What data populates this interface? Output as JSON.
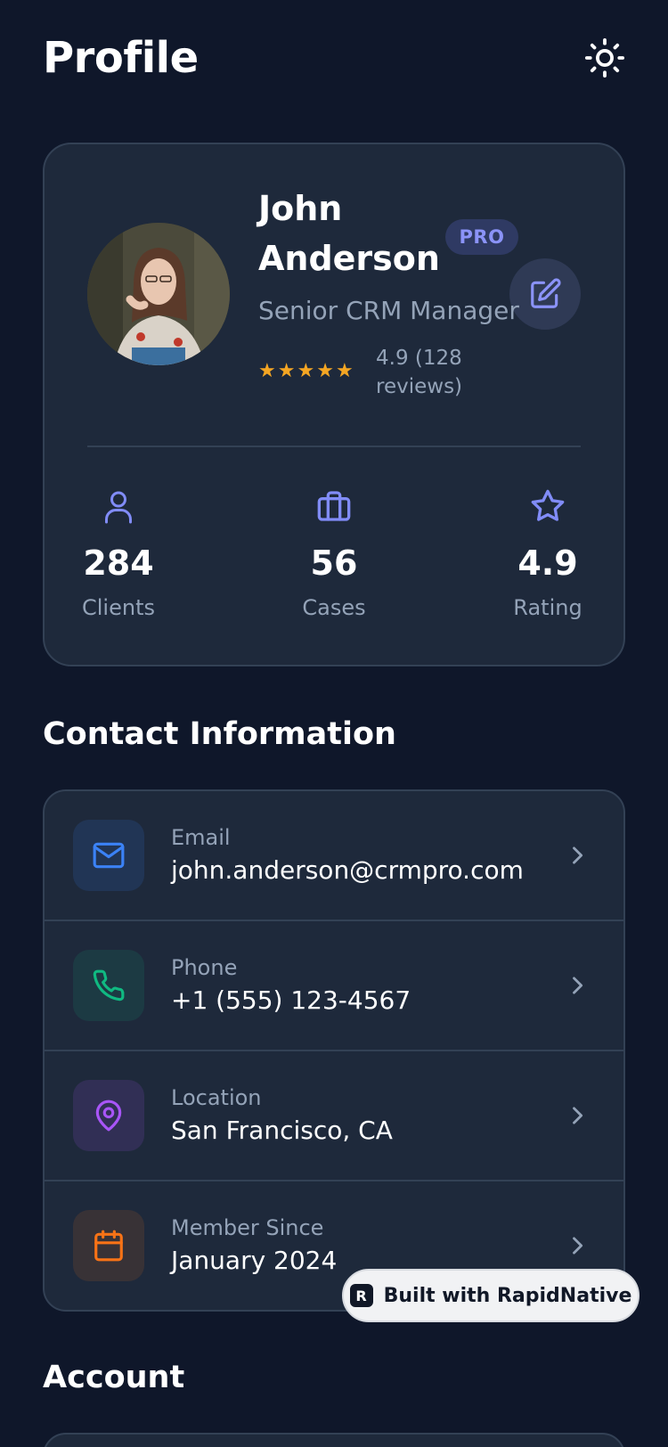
{
  "header": {
    "title": "Profile",
    "theme_icon": "sun-icon"
  },
  "profile": {
    "name": "John Anderson",
    "badge": "PRO",
    "role": "Senior CRM Manager",
    "rating_stars": 5,
    "rating_text": "4.9 (128 reviews)"
  },
  "stats": [
    {
      "icon": "user-icon",
      "value": "284",
      "label": "Clients"
    },
    {
      "icon": "briefcase-icon",
      "value": "56",
      "label": "Cases"
    },
    {
      "icon": "star-icon",
      "value": "4.9",
      "label": "Rating"
    }
  ],
  "contact": {
    "title": "Contact Information",
    "items": [
      {
        "icon": "mail-icon",
        "label": "Email",
        "value": "john.anderson@crmpro.com",
        "color": "#3b82f6"
      },
      {
        "icon": "phone-icon",
        "label": "Phone",
        "value": "+1 (555) 123-4567",
        "color": "#10b981"
      },
      {
        "icon": "map-pin-icon",
        "label": "Location",
        "value": "San Francisco, CA",
        "color": "#a855f7"
      },
      {
        "icon": "calendar-icon",
        "label": "Member Since",
        "value": "January 2024",
        "color": "#f97316"
      }
    ]
  },
  "account": {
    "title": "Account"
  },
  "built_badge": {
    "text": "Built with RapidNative"
  },
  "colors": {
    "background": "#0f172a",
    "card": "#1e293b",
    "accent": "#818cf8",
    "muted": "#94a3b8",
    "star": "#f5a623"
  }
}
